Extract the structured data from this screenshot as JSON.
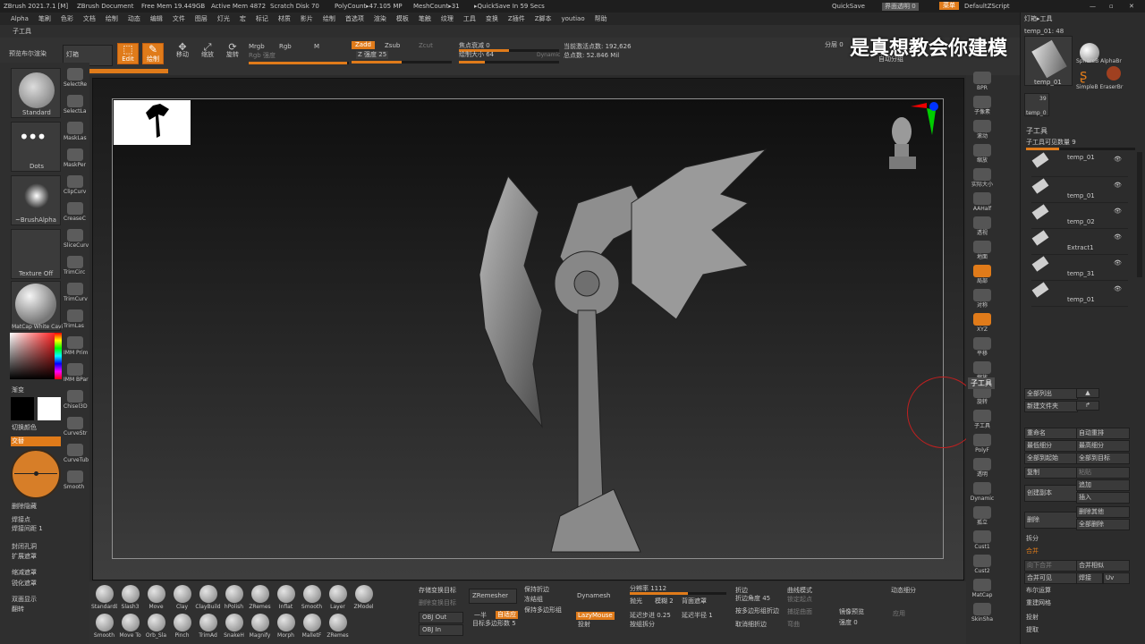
{
  "titlebar": {
    "app": "ZBrush 2021.7.1 [M]",
    "doc": "ZBrush Document",
    "free_mem": "Free Mem 19.449GB",
    "active_mem": "Active Mem 4872",
    "scratch": "Scratch Disk 70",
    "poly": "PolyCount▸47.105 MP",
    "mesh": "MeshCount▸31",
    "quicksave": "▸QuickSave In 59 Secs",
    "menus": "菜单",
    "quick": "QuickSave",
    "trans": "界面透明 0",
    "default_script": "DefaultZScript"
  },
  "menubar": [
    "Alpha",
    "笔刷",
    "色彩",
    "文档",
    "绘制",
    "动态",
    "编辑",
    "文件",
    "图层",
    "灯光",
    "宏",
    "标记",
    "材质",
    "影片",
    "绘制",
    "首选项",
    "渲染",
    "模板",
    "笔触",
    "纹理",
    "工具",
    "变换",
    "Z插件",
    "Z脚本",
    "youtiao",
    "帮助"
  ],
  "toolrow": {
    "left": "子工具"
  },
  "topshelf": {
    "preview": "预览布尔渲染",
    "lamp": "灯箱",
    "edit": "Edit",
    "draw": "绘制",
    "move": "移动",
    "scale": "缩放",
    "rotate": "旋转",
    "mrgb": "Mrgb",
    "rgb": "Rgb",
    "m": "M",
    "rgb_strength": "Rgb 强度",
    "zadd": "Zadd",
    "zsub": "Zsub",
    "zcut": "Zcut",
    "z_intensity": "Z 强度 25",
    "focal": "焦点衰减 0",
    "draw_size": "绘制大小 64",
    "dynamic": "Dynamic",
    "active_points": "当前激活点数: 192,626",
    "total_points": "总点数: 52.846 Mil",
    "mirror": "分层 0",
    "auto_group": "自动分组",
    "watermark": "是真想教会你建模"
  },
  "leftpanel": {
    "brushes": [
      {
        "label": "Standard",
        "side": "SelectRe"
      },
      {
        "label": "Dots",
        "side": "SelectLa"
      },
      {
        "label": "~BrushAlpha",
        "side": "MaskLas"
      },
      {
        "label": "Texture Off",
        "side": "MaskPer"
      },
      {
        "label": "MatCap White Cavi",
        "side": "ClipCurv"
      }
    ],
    "side_tools": [
      "SelectRe",
      "SelectLa",
      "MaskLas",
      "MaskPer",
      "ClipCurv",
      "CreaseC",
      "SliceCurv",
      "TrimCirc",
      "TrimCurv",
      "TrimLas",
      "IMM Prim",
      "IMM BPar",
      "Chisel3D",
      "CurveStr",
      "CurveTub",
      "Smooth"
    ],
    "gradient": "渐变",
    "switch_color": "切换颜色",
    "alternate": "交替",
    "delete_hidden": "删除隐藏",
    "weld_points": "焊接点",
    "weld_dist": "焊接间距 1",
    "close_holes": "封闭孔洞",
    "expand_mask": "扩展遮罩",
    "shrink_mask": "缩减遮罩",
    "sharpen_mask": "锐化遮罩",
    "double_sided": "双面显示",
    "flip": "翻转"
  },
  "rightshelf": [
    "BPR",
    "子像素",
    "滚动",
    "缩放",
    "实际大小",
    "AAHalf",
    "透视",
    "地面",
    "局部",
    "对称",
    "XYZ",
    "平移",
    "缩放",
    "旋转",
    "子工具",
    "PolyF",
    "透明",
    "Dynamic",
    "孤立",
    "Cust1",
    "Cust2",
    "MatCap",
    "SkinSha"
  ],
  "rightpanel": {
    "header": "灯箱▸工具",
    "thumb_count": "temp_01: 48",
    "thumbs": [
      "temp_01",
      "SphereB AlphaBr",
      "SimpleB EraserBr"
    ],
    "temp0": "temp_0",
    "thumb_num": "39",
    "subtool_title": "子工具",
    "visible_count": "子工具可见数量 9",
    "subtools": [
      "temp_01",
      "temp_01",
      "temp_02",
      "Extract1",
      "temp_31",
      "temp_01"
    ],
    "list_all": "全部列出",
    "new_folder": "新建文件夹",
    "rename": "重命名",
    "auto_reorder": "自动重排",
    "lowest_sub": "最低细分",
    "highest_sub": "最高细分",
    "all_to_start": "全部到起始",
    "all_to_target": "全部到目标",
    "copy": "复制",
    "paste": "粘贴",
    "duplicate": "创建副本",
    "append": "追加",
    "insert": "插入",
    "delete": "删除",
    "del_other": "删除其他",
    "del_all": "全部删除",
    "split": "拆分",
    "merge": "合并",
    "merge_down": "向下合并",
    "merge_similar": "合并相似",
    "merge_visible": "合并可见",
    "weld": "焊接",
    "uv": "Uv",
    "boolean": "布尔运算",
    "remesh": "重建网格",
    "project": "投射",
    "extract": "提取",
    "subtool_tooltip": "子工具"
  },
  "bottomshelf": {
    "brushes": [
      "StandardDamSta",
      "Slash3",
      "Move",
      "Clay",
      "ClayBuild",
      "hPolish",
      "ZRemes",
      "Inflat",
      "Smooth",
      "Layer",
      "ZModel"
    ],
    "brushes2": [
      "Smooth",
      "Move To",
      "Orb_Sla",
      "Pinch",
      "TrimAd",
      "SnakeH",
      "Magnify",
      "Morph",
      "MalletF",
      "ZRemes"
    ],
    "store_morph": "存储变换目标",
    "del_morph": "删除变换目标",
    "obj_out": "OBJ Out",
    "obj_in": "OBJ In",
    "zremesher": "ZRemesher",
    "keep_creases": "保持折边",
    "freeze_group": "冻结组",
    "keep_polygroup": "保持多边形组",
    "half": "一半",
    "adaptive": "自适应",
    "target_poly": "目标多边形数 5",
    "dynamesh": "Dynamesh",
    "lazymouse": "LazyMouse",
    "project_btn": "投射",
    "resolution": "分辨率 1112",
    "polish": "抛光",
    "blur": "模糊 2",
    "backface": "背面遮罩",
    "lazy_step": "延迟步进 0.25",
    "lazy_radius": "延迟半径 1",
    "group_split": "按组拆分",
    "crease": "折边",
    "crease_angle": "折边角度 45",
    "by_group_crease": "按多边形组折边",
    "uncrease_all": "取消细折边",
    "curve_mode": "曲线模式",
    "lock_start": "锁定起点",
    "snap": "捕捉曲面",
    "bend": "弯曲",
    "dynamic_sub": "动态细分",
    "intensity": "强度 0",
    "apply": "应用",
    "mirror_preview": "镜像预览"
  },
  "colors": {
    "accent": "#e07b1a",
    "panel": "#2c2c2c"
  }
}
